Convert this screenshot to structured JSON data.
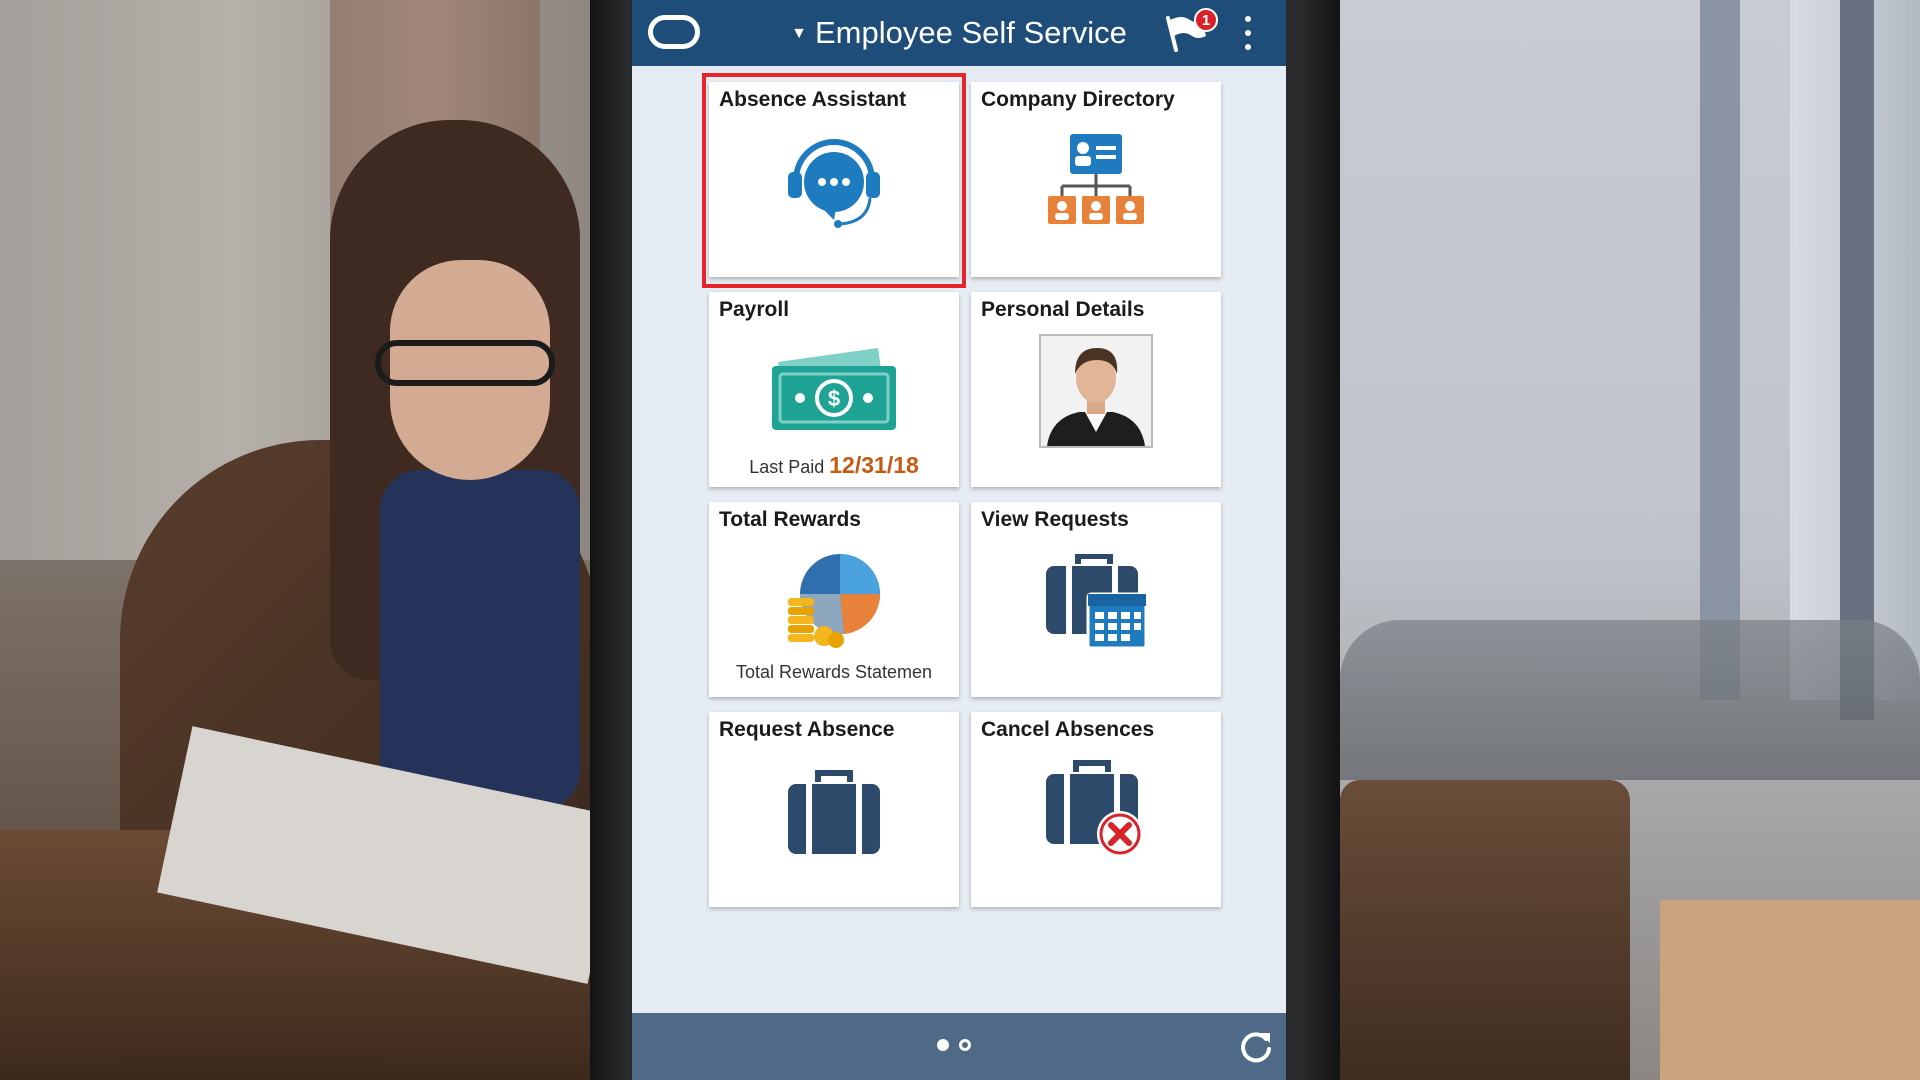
{
  "header": {
    "title": "Employee Self Service",
    "notification_count": "1"
  },
  "tiles": [
    {
      "title": "Absence Assistant",
      "icon": "headset-chat-icon",
      "selected": true
    },
    {
      "title": "Company Directory",
      "icon": "org-chart-icon"
    },
    {
      "title": "Payroll",
      "icon": "money-icon",
      "subtitle_prefix": "Last Paid",
      "subtitle_value": "12/31/18"
    },
    {
      "title": "Personal Details",
      "icon": "profile-photo-icon"
    },
    {
      "title": "Total Rewards",
      "icon": "pie-chart-coins-icon",
      "subtitle": "Total Rewards Statemen"
    },
    {
      "title": "View Requests",
      "icon": "briefcase-calendar-icon"
    },
    {
      "title": "Request Absence",
      "icon": "briefcase-icon"
    },
    {
      "title": "Cancel Absences",
      "icon": "briefcase-cancel-icon"
    }
  ],
  "footer": {
    "pages": 2,
    "current_page": 1
  },
  "colors": {
    "header_bg": "#1f4d79",
    "footer_bg": "#4f6a87",
    "selection_outline": "#e8242b",
    "accent_blue": "#1f7bbf",
    "accent_orange": "#e8823a",
    "payroll_green": "#1ea394",
    "briefcase": "#2e4a6b"
  }
}
